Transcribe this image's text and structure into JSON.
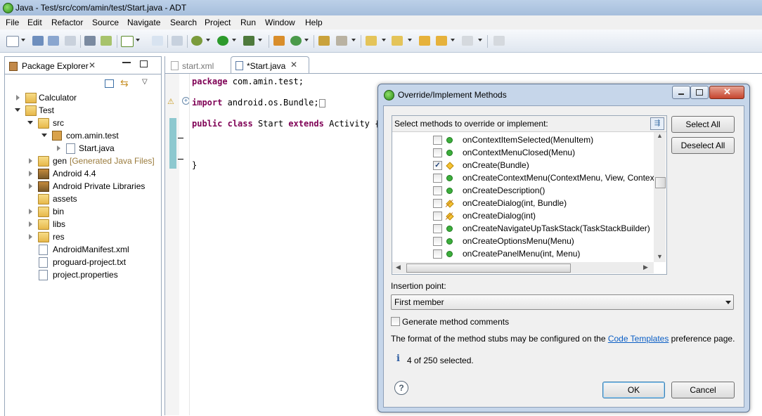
{
  "window": {
    "title": "Java - Test/src/com/amin/test/Start.java - ADT"
  },
  "menu": [
    "File",
    "Edit",
    "Refactor",
    "Source",
    "Navigate",
    "Search",
    "Project",
    "Run",
    "Window",
    "Help"
  ],
  "package_explorer": {
    "tab_label": "Package Explorer",
    "items": [
      {
        "label": "Calculator"
      },
      {
        "label": "Test"
      },
      {
        "label": "src"
      },
      {
        "label": "com.amin.test"
      },
      {
        "label": "Start.java"
      },
      {
        "label": "gen",
        "decoration": "[Generated Java Files]"
      },
      {
        "label": "Android 4.4"
      },
      {
        "label": "Android Private Libraries"
      },
      {
        "label": "assets"
      },
      {
        "label": "bin"
      },
      {
        "label": "libs"
      },
      {
        "label": "res"
      },
      {
        "label": "AndroidManifest.xml"
      },
      {
        "label": "proguard-project.txt"
      },
      {
        "label": "project.properties"
      }
    ]
  },
  "editor": {
    "tabs": [
      {
        "label": "start.xml"
      },
      {
        "label": "*Start.java"
      }
    ],
    "code": {
      "kw_package": "package",
      "package_name": " com.amin.test;",
      "kw_import": "import",
      "import_name": " android.os.Bundle;",
      "kw_public": "public",
      "kw_class": "class",
      "class_name": " Start ",
      "kw_extends": "extends",
      "parent": " Activity {",
      "closing": "}"
    }
  },
  "dialog": {
    "title": "Override/Implement Methods",
    "select_label": "Select methods to override or implement:",
    "select_all": "Select All",
    "deselect_all": "Deselect All",
    "methods": [
      {
        "name": "onContextItemSelected(MenuItem)",
        "checked": false,
        "icon": "public-method-icon"
      },
      {
        "name": "onContextMenuClosed(Menu)",
        "checked": false,
        "icon": "public-method-icon"
      },
      {
        "name": "onCreate(Bundle)",
        "checked": true,
        "icon": "protected-method-icon"
      },
      {
        "name": "onCreateContextMenu(ContextMenu, View, Contex",
        "checked": false,
        "icon": "public-method-icon"
      },
      {
        "name": "onCreateDescription()",
        "checked": false,
        "icon": "public-method-icon"
      },
      {
        "name": "onCreateDialog(int, Bundle)",
        "checked": false,
        "icon": "deprecated-method-icon"
      },
      {
        "name": "onCreateDialog(int)",
        "checked": false,
        "icon": "deprecated-method-icon"
      },
      {
        "name": "onCreateNavigateUpTaskStack(TaskStackBuilder)",
        "checked": false,
        "icon": "public-method-icon"
      },
      {
        "name": "onCreateOptionsMenu(Menu)",
        "checked": false,
        "icon": "public-method-icon"
      },
      {
        "name": "onCreatePanelMenu(int, Menu)",
        "checked": false,
        "icon": "public-method-icon"
      }
    ],
    "insertion_label": "Insertion point:",
    "insertion_value": "First member",
    "generate_comments_label": "Generate method comments",
    "info_prefix": "The format of the method stubs may be configured on the ",
    "info_link": "Code Templates",
    "info_suffix": " preference page.",
    "status": "4 of 250 selected.",
    "ok": "OK",
    "cancel": "Cancel"
  }
}
